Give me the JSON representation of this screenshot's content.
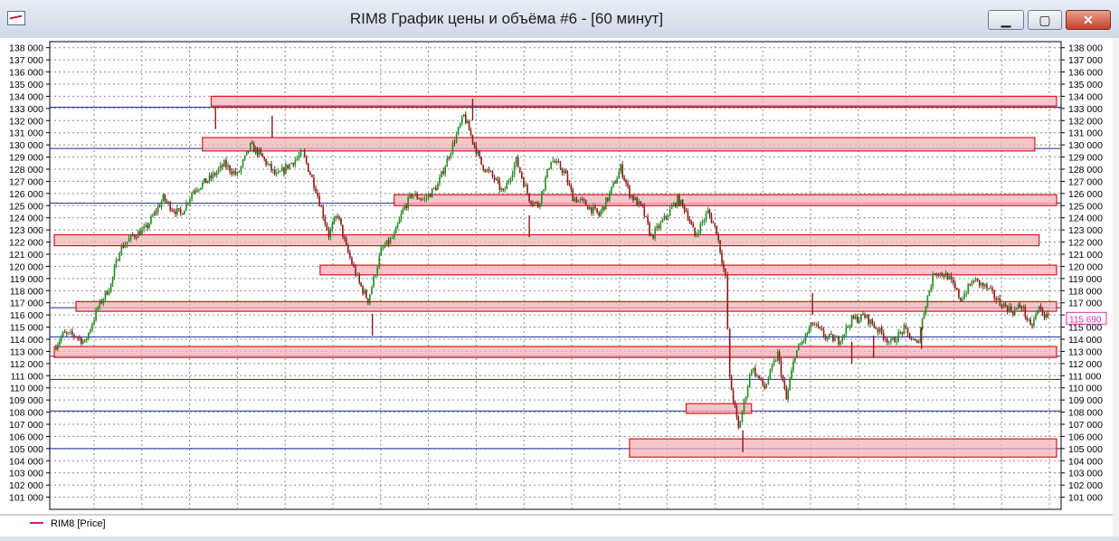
{
  "window": {
    "title": "RIM8 График цены и объёма #6 - [60 минут]",
    "minimize_glyph": "▁",
    "maximize_glyph": "▢",
    "close_glyph": "✕"
  },
  "legend": {
    "label": "RIM8 [Price]",
    "color": "#d4189a"
  },
  "colors": {
    "up": "#1f8a1f",
    "down": "#8b1a1a",
    "zone_fill": "#f4b3b8",
    "zone_stroke": "#e0141e",
    "level_line": "#1a2a9a",
    "price_tag": "#cc33aa"
  },
  "chart_data": {
    "type": "candlestick",
    "ylim": [
      100000,
      138500
    ],
    "y_ticks": [
      "101 000",
      "102 000",
      "103 000",
      "104 000",
      "105 000",
      "106 000",
      "107 000",
      "108 000",
      "109 000",
      "110 000",
      "111 000",
      "112 000",
      "113 000",
      "114 000",
      "115 000",
      "116 000",
      "117 000",
      "118 000",
      "119 000",
      "120 000",
      "121 000",
      "122 000",
      "123 000",
      "124 000",
      "125 000",
      "126 000",
      "127 000",
      "128 000",
      "129 000",
      "130 000",
      "131 000",
      "132 000",
      "133 000",
      "134 000",
      "135 000",
      "136 000",
      "137 000",
      "138 000"
    ],
    "y_tick_values": [
      101000,
      102000,
      103000,
      104000,
      105000,
      106000,
      107000,
      108000,
      109000,
      110000,
      111000,
      112000,
      113000,
      114000,
      115000,
      116000,
      117000,
      118000,
      119000,
      120000,
      121000,
      122000,
      123000,
      124000,
      125000,
      126000,
      127000,
      128000,
      129000,
      130000,
      131000,
      132000,
      133000,
      134000,
      135000,
      136000,
      137000,
      138000
    ],
    "last_price_label": "115 690",
    "last_price": 115690,
    "path": [
      [
        0,
        113300
      ],
      [
        2,
        114400
      ],
      [
        5,
        114300
      ],
      [
        7,
        113700
      ],
      [
        10,
        116600
      ],
      [
        13,
        118500
      ],
      [
        15,
        121400
      ],
      [
        18,
        122500
      ],
      [
        21,
        123100
      ],
      [
        25,
        125600
      ],
      [
        27,
        124800
      ],
      [
        29,
        124300
      ],
      [
        32,
        126300
      ],
      [
        36,
        127300
      ],
      [
        39,
        128400
      ],
      [
        42,
        127500
      ],
      [
        45,
        129900
      ],
      [
        47,
        129300
      ],
      [
        51,
        127400
      ],
      [
        54,
        128400
      ],
      [
        57,
        129300
      ],
      [
        60,
        126400
      ],
      [
        63,
        122600
      ],
      [
        65,
        124300
      ],
      [
        67,
        121500
      ],
      [
        70,
        118600
      ],
      [
        72,
        117200
      ],
      [
        75,
        121300
      ],
      [
        78,
        122500
      ],
      [
        80,
        124600
      ],
      [
        82,
        125900
      ],
      [
        85,
        125500
      ],
      [
        88,
        126700
      ],
      [
        91,
        129600
      ],
      [
        94,
        132400
      ],
      [
        96,
        130400
      ],
      [
        98,
        128400
      ],
      [
        101,
        127200
      ],
      [
        103,
        126000
      ],
      [
        106,
        128700
      ],
      [
        109,
        125600
      ],
      [
        111,
        125000
      ],
      [
        114,
        128800
      ],
      [
        117,
        127800
      ],
      [
        119,
        125700
      ],
      [
        122,
        125100
      ],
      [
        125,
        124200
      ],
      [
        127,
        125600
      ],
      [
        130,
        128100
      ],
      [
        132,
        126000
      ],
      [
        135,
        124700
      ],
      [
        137,
        122400
      ],
      [
        140,
        123900
      ],
      [
        143,
        125500
      ],
      [
        145,
        124600
      ],
      [
        147,
        122500
      ],
      [
        150,
        124500
      ],
      [
        152,
        122900
      ],
      [
        154,
        119000
      ],
      [
        155,
        110700
      ],
      [
        157,
        106600
      ],
      [
        160,
        111700
      ],
      [
        163,
        110000
      ],
      [
        166,
        112800
      ],
      [
        168,
        109000
      ],
      [
        170,
        112800
      ],
      [
        172,
        114000
      ],
      [
        174,
        115300
      ],
      [
        177,
        114200
      ],
      [
        180,
        113900
      ],
      [
        183,
        115600
      ],
      [
        186,
        115900
      ],
      [
        189,
        114800
      ],
      [
        192,
        113700
      ],
      [
        195,
        114800
      ],
      [
        198,
        113500
      ],
      [
        200,
        117000
      ],
      [
        202,
        119600
      ],
      [
        205,
        119200
      ],
      [
        208,
        117300
      ],
      [
        211,
        118900
      ],
      [
        214,
        118200
      ],
      [
        217,
        117000
      ],
      [
        220,
        116300
      ],
      [
        222,
        116800
      ],
      [
        224,
        114900
      ],
      [
        226,
        116600
      ],
      [
        228,
        115600
      ]
    ],
    "spikes": [
      [
        37,
        133100,
        0.5
      ],
      [
        50,
        130600,
        -0.5
      ],
      [
        73,
        114300,
        -0.5
      ],
      [
        96,
        133800,
        0.5
      ],
      [
        109,
        122400,
        -0.5
      ],
      [
        158,
        104700,
        -0.5
      ],
      [
        174,
        117800,
        0.5
      ],
      [
        183,
        112000,
        -0.5
      ],
      [
        188,
        112500,
        -0.5
      ],
      [
        199,
        113200,
        -0.5
      ]
    ],
    "zones": [
      {
        "x0": 36,
        "x1": 230,
        "y0": 133200,
        "y1": 134000
      },
      {
        "x0": 34,
        "x1": 225,
        "y0": 129500,
        "y1": 130600
      },
      {
        "x0": 78,
        "x1": 230,
        "y0": 125000,
        "y1": 125900
      },
      {
        "x0": 0,
        "x1": 226,
        "y0": 121700,
        "y1": 122600
      },
      {
        "x0": 61,
        "x1": 230,
        "y0": 119300,
        "y1": 120100
      },
      {
        "x0": 5,
        "x1": 230,
        "y0": 116300,
        "y1": 117100
      },
      {
        "x0": 0,
        "x1": 230,
        "y0": 112500,
        "y1": 113400
      },
      {
        "x0": 145,
        "x1": 160,
        "y0": 107900,
        "y1": 108700
      },
      {
        "x0": 132,
        "x1": 230,
        "y0": 104300,
        "y1": 105800
      }
    ],
    "levels": [
      133100,
      129700,
      125200,
      116600,
      114200,
      112600,
      110700,
      108100,
      105000
    ],
    "xlim": [
      0,
      230
    ]
  }
}
